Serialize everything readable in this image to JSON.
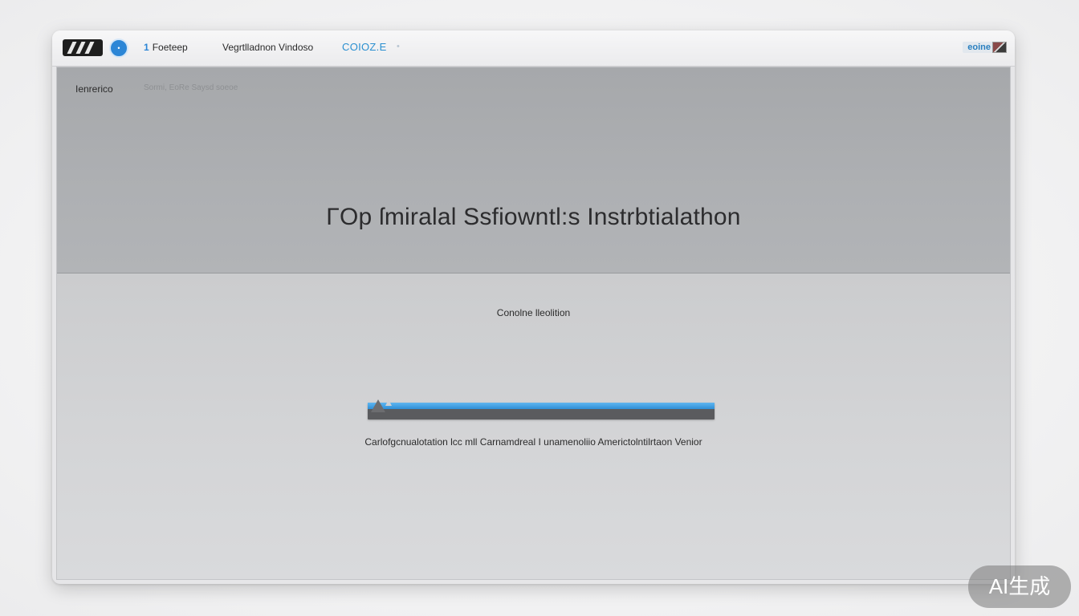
{
  "window": {
    "nav": {
      "step_number": "1",
      "step_label": "Foeteep",
      "item_2": "Vegrtlladnon  Vindoso",
      "active_item": "COIOZ.E",
      "faint_item": "•"
    },
    "right_label": "eoine"
  },
  "hero": {
    "crumb": "Ienrerico",
    "crumb_sub": "Sormi, EoRe Saysd soeoe",
    "title": "ΓOp ſmiralal Ssfiowntl:s Instrbtialathon"
  },
  "install": {
    "section_label": "Conolne lleolition",
    "progress": 1.0,
    "caption": "Carlofgcnualotation lcc mll Carnamdreal I unamenoliio Americtolntilrtaon Venior"
  },
  "watermark": "AI生成",
  "colors": {
    "accent": "#2c86d6",
    "progress_fill": "#3a9ae0",
    "hero_bg": "#aaacaf"
  }
}
